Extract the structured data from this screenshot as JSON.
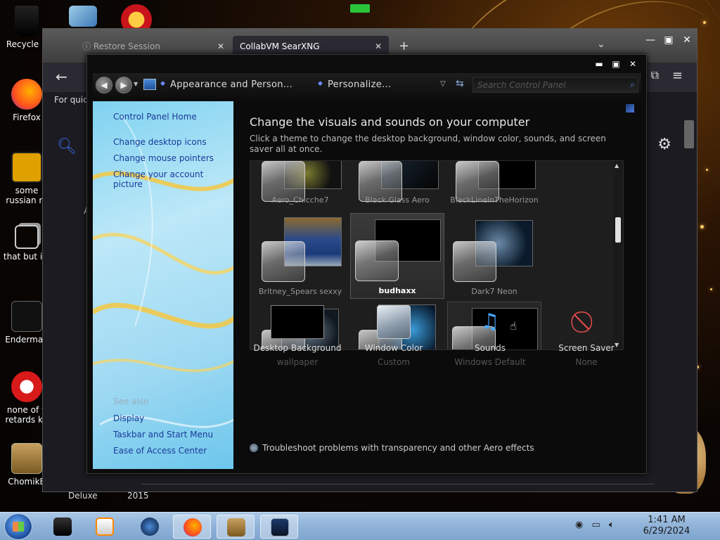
{
  "desktop": {
    "icons": [
      {
        "label": "Recycle B"
      },
      {
        "label": "Firefox"
      },
      {
        "label": "some russian ra"
      },
      {
        "label": "that but its"
      },
      {
        "label": "Enderman"
      },
      {
        "label": "none of y retards kn"
      },
      {
        "label": "ChomikB"
      }
    ],
    "extra_labels": [
      "Deluxe",
      "2015"
    ]
  },
  "browser": {
    "tabs": [
      {
        "label": "Restore Session"
      },
      {
        "label": "CollabVM SearXNG"
      }
    ],
    "quick_text": "For quick",
    "partial_text": "A"
  },
  "control_panel": {
    "breadcrumb": [
      "Appearance and Person...",
      "Personalize..."
    ],
    "search_placeholder": "Search Control Panel",
    "left_links": [
      "Control Panel Home",
      "Change desktop icons",
      "Change mouse pointers",
      "Change your account picture"
    ],
    "see_also_label": "See also",
    "see_also_links": [
      "Display",
      "Taskbar and Start Menu",
      "Ease of Access Center"
    ],
    "title": "Change the visuals and sounds on your computer",
    "subtitle": "Click a theme to change the desktop background, window color, sounds, and screen saver all at once.",
    "themes": [
      {
        "name": "Aero_Chicche7"
      },
      {
        "name": "Black Glass Aero"
      },
      {
        "name": "BlackLineInTheHorizon"
      },
      {
        "name": "Britney_Spears sexxy"
      },
      {
        "name": "budhaxx",
        "selected": true
      },
      {
        "name": "Dark7 Neon"
      }
    ],
    "options": [
      {
        "name": "Desktop Background",
        "value": "wallpaper"
      },
      {
        "name": "Window Color",
        "value": "Custom"
      },
      {
        "name": "Sounds",
        "value": "Windows Default"
      },
      {
        "name": "Screen Saver",
        "value": "None"
      }
    ],
    "troubleshoot": "Troubleshoot problems with transparency and other Aero effects"
  },
  "taskbar": {
    "time": "1:41 AM",
    "date": "6/29/2024"
  },
  "colors": {
    "link": "#1a3a9a",
    "taskbar": "#8fb2d8",
    "window_bg": "#0b0b0b"
  }
}
